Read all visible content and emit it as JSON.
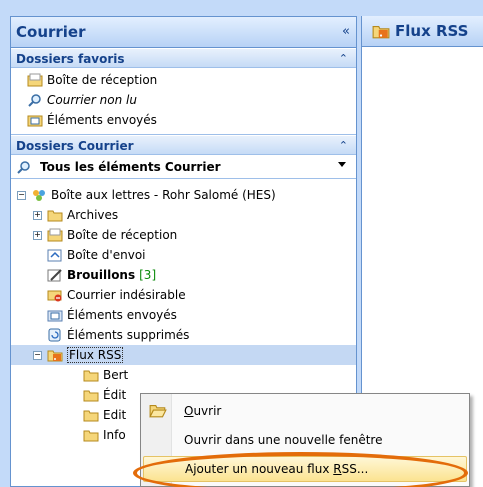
{
  "nav": {
    "title": "Courrier",
    "collapse": "«",
    "favorites": {
      "title": "Dossiers favoris",
      "chevron": "⌃",
      "items": [
        {
          "label": "Boîte de réception",
          "italic": false
        },
        {
          "label": "Courrier non lu",
          "italic": true
        },
        {
          "label": "Éléments envoyés",
          "italic": false
        }
      ]
    },
    "mail_folders": {
      "title": "Dossiers Courrier",
      "chevron": "⌃",
      "all_items_label": "Tous les éléments Courrier"
    },
    "tree": {
      "mailbox": {
        "expander": "−",
        "label": "Boîte aux lettres - Rohr Salomé (HES)"
      },
      "folders": [
        {
          "expander": "+",
          "label": "Archives"
        },
        {
          "expander": "+",
          "label": "Boîte de réception"
        },
        {
          "label": "Boîte d'envoi"
        },
        {
          "label": "Brouillons",
          "count": "[3]",
          "bold": true
        },
        {
          "label": "Courrier indésirable"
        },
        {
          "label": "Éléments envoyés"
        },
        {
          "label": "Éléments supprimés"
        },
        {
          "expander": "−",
          "label": "Flux RSS",
          "selected": true
        }
      ],
      "rss_children": [
        "Bert",
        "Édit",
        "Edit",
        "Info"
      ]
    }
  },
  "right_pane": {
    "title": "Flux RSS"
  },
  "context_menu": {
    "items": [
      {
        "label_pre": "",
        "label_u": "O",
        "label_post": "uvrir"
      },
      {
        "label_pre": "Ouvrir dans une nouvelle fenêtre",
        "label_u": "",
        "label_post": ""
      },
      {
        "label_pre": "Ajouter un nouveau flux ",
        "label_u": "R",
        "label_post": "SS..."
      }
    ]
  },
  "colors": {
    "accent": "#15428b",
    "highlight_ring": "#e36c0a",
    "count": "#0a8a0a"
  }
}
